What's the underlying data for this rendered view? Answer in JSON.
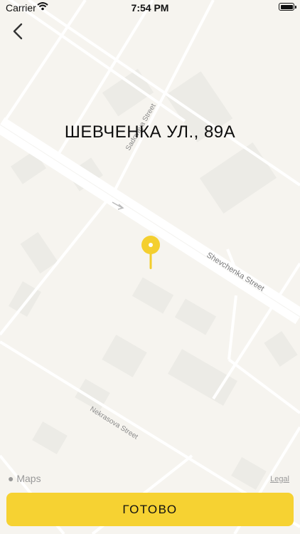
{
  "status_bar": {
    "carrier": "Carrier",
    "time": "7:54 PM"
  },
  "header": {
    "title": "ШЕВЧЕНКА УЛ., 89А"
  },
  "map": {
    "streets": [
      "Shevchenka Street",
      "Sadovaya Street",
      "Nekrasova Street"
    ],
    "attribution": "Maps",
    "legal": "Legal"
  },
  "footer": {
    "done_label": "ГОТОВО"
  },
  "colors": {
    "accent": "#f6d232",
    "map_background": "#f6f4ef"
  }
}
